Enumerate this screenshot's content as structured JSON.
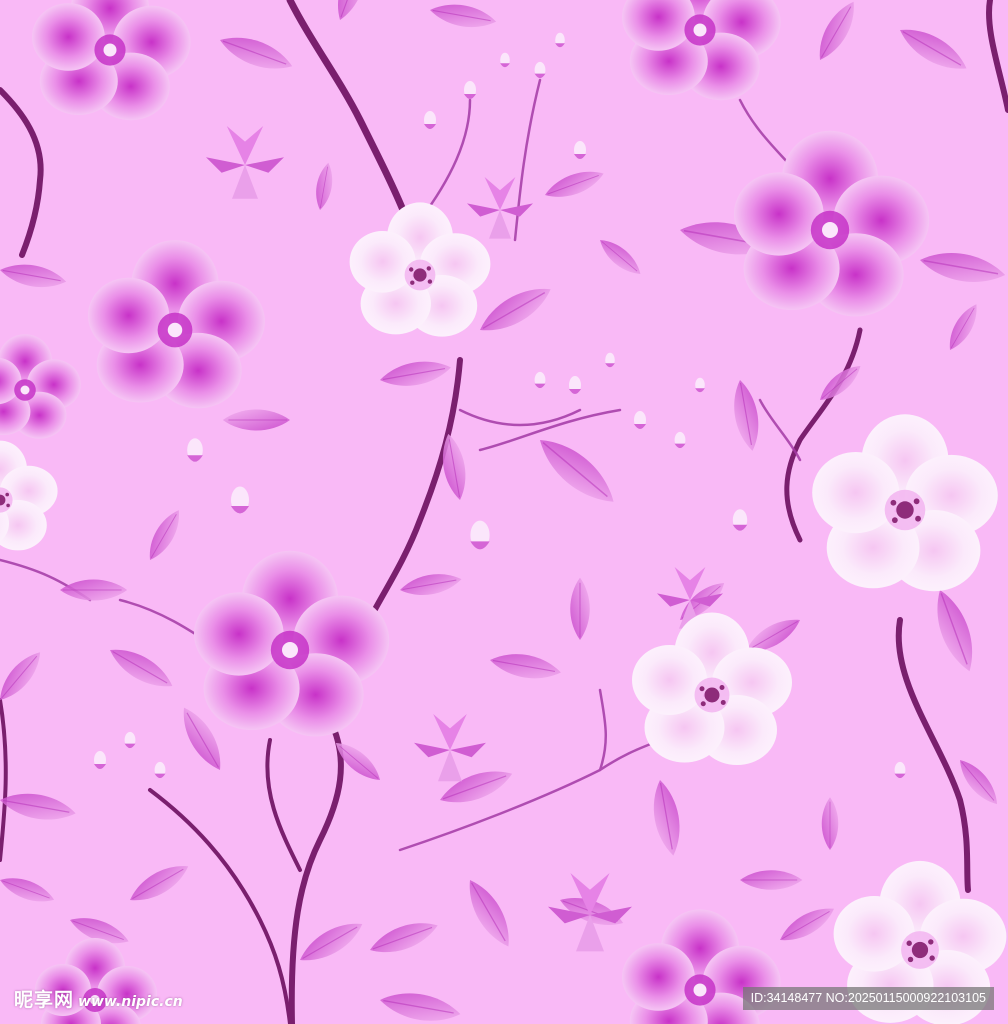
{
  "palette": {
    "background": "#f9b9f6",
    "petal_light": "#fbeefc",
    "petal_mid": "#f2a6ef",
    "petal_deep": "#d24ed3",
    "leaf": "#de72e1",
    "leaf_dark": "#b52fb8",
    "stem": "#7a1f6e",
    "center": "#8e2c7a"
  },
  "watermark": {
    "logo_text": "昵享网",
    "url_text": "www.nipic.cn",
    "id_text": "ID:34148477 NO:20250115000922103105"
  }
}
